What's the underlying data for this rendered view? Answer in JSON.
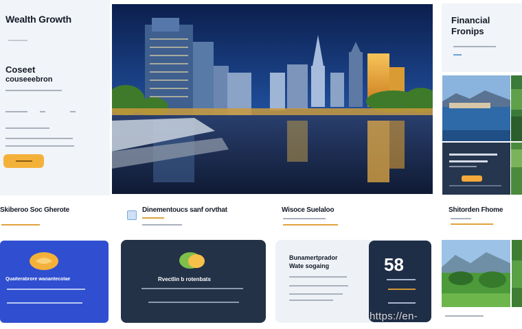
{
  "hero": {
    "brand": "Wealth Growth",
    "brand_sub": "",
    "title_line1": "Coseet",
    "title_line2": "couseeebron",
    "caption": "",
    "lines": [
      "",
      "",
      ""
    ],
    "cta_label": ""
  },
  "right": {
    "title_line1": "Financial",
    "title_line2": "Fronips",
    "caption": ""
  },
  "features": [
    {
      "title": "Skiberoo Soc Gherote",
      "sub": ""
    },
    {
      "title": "Dinementoucs sanf orvthat",
      "sub": ""
    },
    {
      "title": "Wisoce Suelaloo",
      "sub": ""
    },
    {
      "title": "Shitorden Fhome",
      "sub": ""
    }
  ],
  "cards": {
    "blue": {
      "title": "Quaiterabrore waoantecolae",
      "lines": [
        "",
        ""
      ]
    },
    "navy": {
      "title": "Rvectlin b rotenbats",
      "lines": [
        "",
        ""
      ]
    },
    "light": {
      "title_line1": "Bunamertprador",
      "title_line2": "Wate sogaing",
      "lines": [
        "",
        "",
        ""
      ]
    },
    "stat": {
      "value": "58",
      "lines": [
        "",
        ""
      ]
    }
  },
  "photo_caption": "",
  "watermark": "https://en-"
}
